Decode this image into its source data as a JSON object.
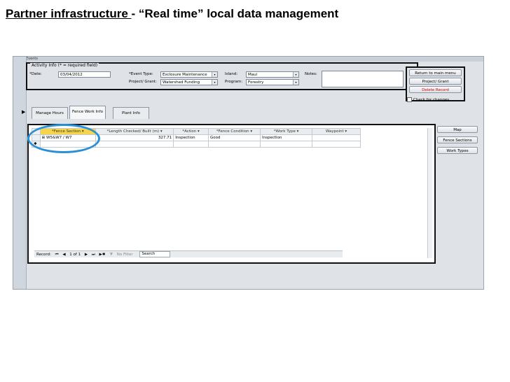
{
  "slide": {
    "title_underlined": "Partner infrastructure ",
    "title_rest": "- “Real time” local data management"
  },
  "app": {
    "window_title": "Events",
    "activity_legend": "Activity Info (* = required field)",
    "date_label": "*Date:",
    "date_value": "03/04/2012",
    "event_type_label": "*Event Type:",
    "event_type_value": "Exclosure Maintenance",
    "island_label": "Island:",
    "island_value": "Maui",
    "notes_label": "Notes:",
    "project_grant_label": "Project/ Grant:",
    "project_grant_value": "Watershed Funding",
    "program_label": "Program:",
    "program_value": "Forestry",
    "buttons": {
      "return_main_menu": "Return to main menu",
      "project_grant": "Project/ Grant",
      "delete_record": "Delete Record",
      "check_for_changes": "Check for changes"
    },
    "tabs": [
      "Manage Hours",
      "Fence Work Info",
      "Plant Info"
    ],
    "grid": {
      "headers": [
        "*Fence Section",
        "*Length Checked/ Built (m)",
        "*Action",
        "*Fence Condition",
        "*Work Type",
        "Waypoint"
      ],
      "rows": [
        {
          "fence_section": "W5&W7 / W7",
          "length": "327.71",
          "action": "Inspection",
          "condition": "Good",
          "work_type": "Inspection",
          "waypoint": ""
        }
      ]
    },
    "navbar": {
      "record_label": "Record:",
      "position": "1 of 1",
      "filter": "No Filter",
      "search": "Search"
    },
    "side_buttons": [
      "Map",
      "Fence Sections",
      "Work Types"
    ],
    "colors": {
      "highlight_circle": "#2b8fd6",
      "selected_cell": "#f7d54a",
      "delete_text": "#cc0000"
    }
  }
}
